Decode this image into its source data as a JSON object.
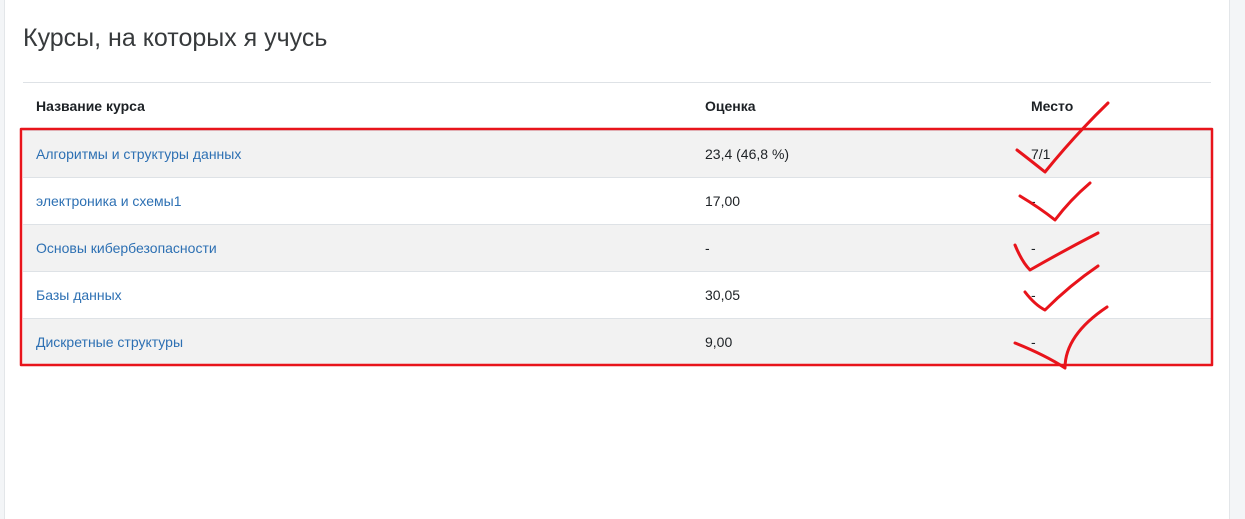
{
  "page": {
    "title": "Курсы, на которых я учусь"
  },
  "table": {
    "headers": {
      "course": "Название курса",
      "grade": "Оценка",
      "rank": "Место"
    },
    "rows": [
      {
        "course": "Алгоритмы и структуры данных",
        "grade": "23,4 (46,8 %)",
        "rank": "7/1"
      },
      {
        "course": "электроника и схемы1",
        "grade": "17,00",
        "rank": "-"
      },
      {
        "course": "Основы кибербезопасности",
        "grade": "-",
        "rank": "-"
      },
      {
        "course": "Базы данных",
        "grade": "30,05",
        "rank": "-"
      },
      {
        "course": "Дискретные структуры",
        "grade": "9,00",
        "rank": "-"
      }
    ]
  },
  "annotations": {
    "color": "#e8141b"
  }
}
